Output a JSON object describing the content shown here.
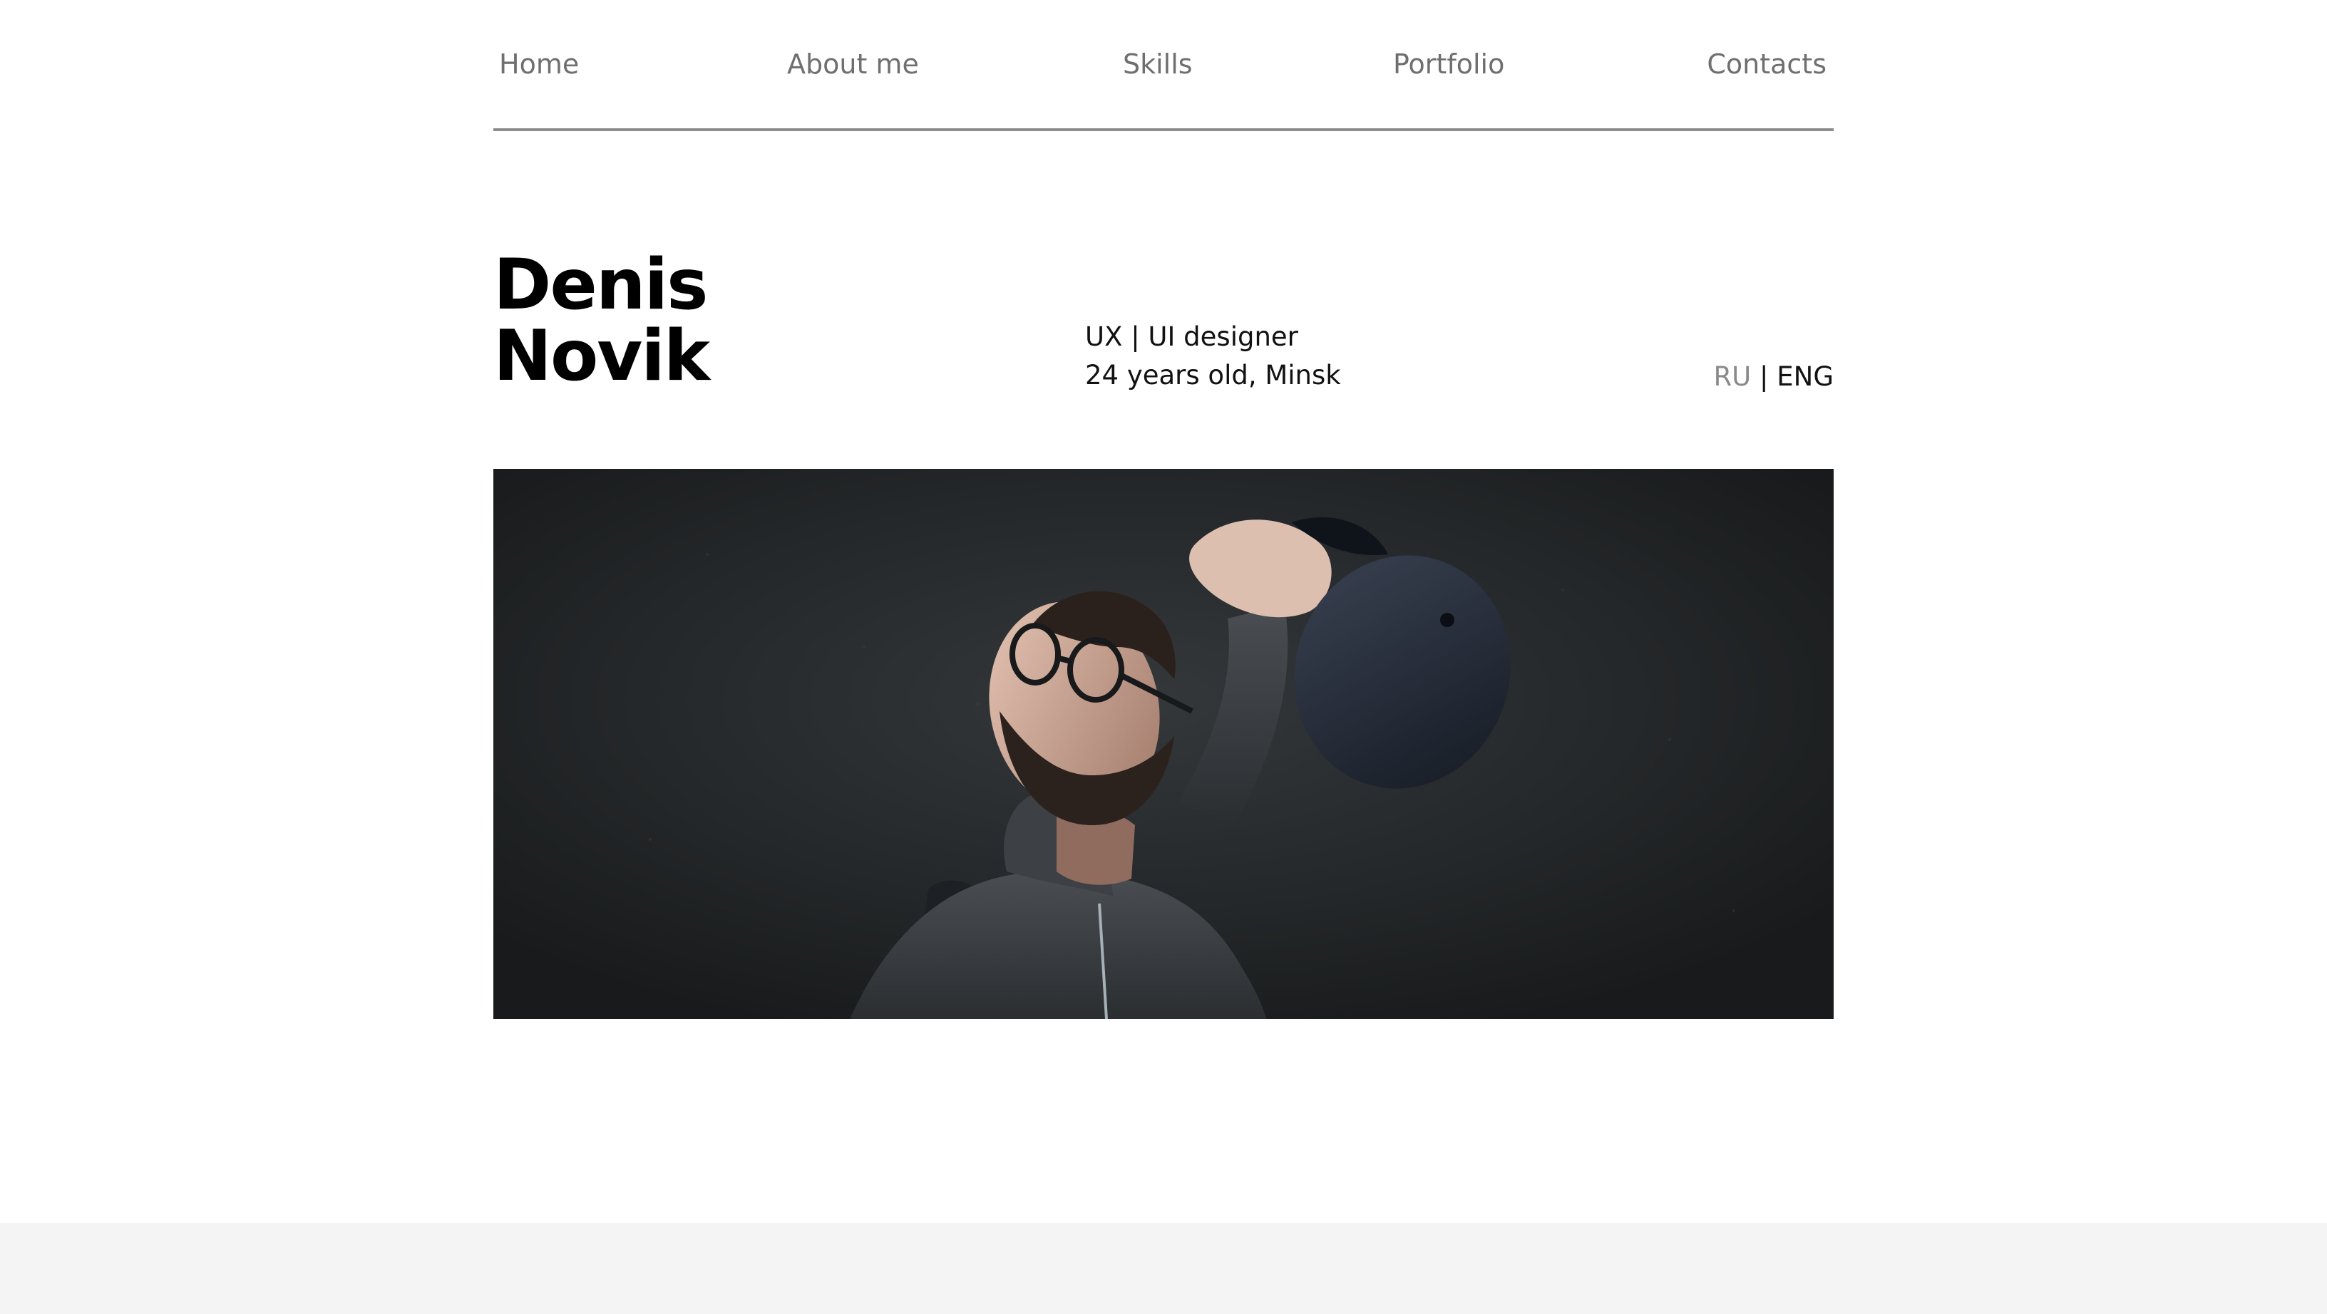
{
  "nav": {
    "items": [
      {
        "label": "Home"
      },
      {
        "label": "About me"
      },
      {
        "label": "Skills"
      },
      {
        "label": "Portfolio"
      },
      {
        "label": "Contacts"
      }
    ]
  },
  "hero": {
    "first_name": "Denis",
    "last_name": "Novik",
    "role": "UX | UI designer",
    "age_location": "24 years old, Minsk"
  },
  "language": {
    "ru": "RU",
    "separator": "|",
    "eng": "ENG",
    "active": "ENG"
  },
  "colors": {
    "nav_text": "#6f6f6f",
    "divider": "#8c8c8c",
    "photo_background": "#202325",
    "footer_band": "#f4f4f4"
  }
}
